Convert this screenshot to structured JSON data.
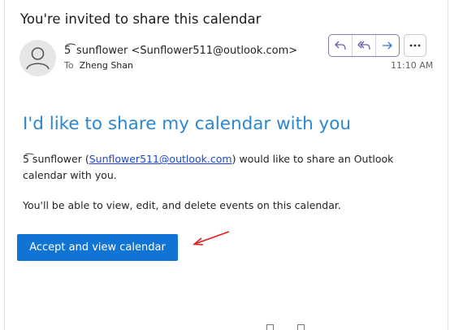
{
  "email": {
    "subject": "You're invited to share this calendar",
    "sender": "5͡  sunflower <Sunflower511@outlook.com>",
    "to_label": "To",
    "to_name": "Zheng Shan",
    "time": "11:10 AM"
  },
  "toolbar": {
    "icons": [
      "reply-icon",
      "reply-all-icon",
      "forward-icon",
      "more-icon"
    ],
    "accent_color": "#8a7ab8"
  },
  "body": {
    "heading": "I'd like to share my calendar with you",
    "para1_name": "5͡ sunflower (",
    "para1_email": "Sunflower511@outlook.com",
    "para1_rest": ") would like to share an Outlook calendar with you.",
    "para2": "You'll be able to view, edit, and delete events on this calendar.",
    "accept_label": "Accept and view calendar",
    "heading_color": "#2b87d1",
    "button_color": "#0f74d3"
  },
  "annotation": {
    "icon": "red-arrow-icon",
    "color": "#e02020"
  }
}
